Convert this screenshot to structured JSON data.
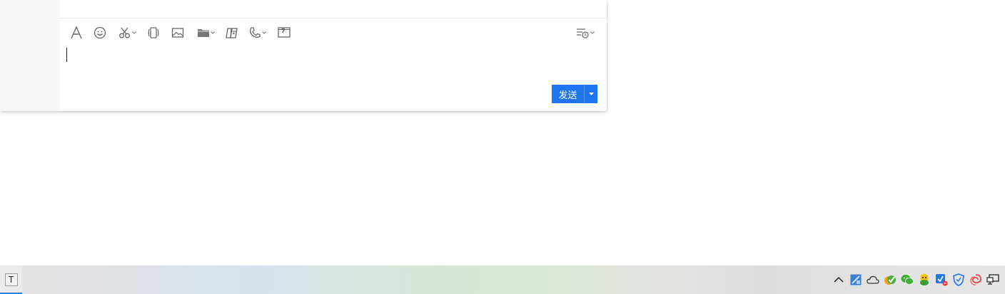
{
  "chat": {
    "toolbar": {
      "items": [
        {
          "name": "font-icon"
        },
        {
          "name": "emoji-icon"
        },
        {
          "name": "screenshot-scissors-icon",
          "dropdown": true
        },
        {
          "name": "shake-window-icon"
        },
        {
          "name": "image-icon"
        },
        {
          "name": "folder-icon",
          "dropdown": true
        },
        {
          "name": "red-packet-icon"
        },
        {
          "name": "phone-call-icon",
          "dropdown": true
        },
        {
          "name": "calendar-7-icon",
          "label": "7"
        }
      ],
      "history_icon": "message-history-icon"
    },
    "input": {
      "value": ""
    },
    "send": {
      "label": "发送",
      "more_icon": "caret-down-icon",
      "color": "#1f75f0"
    }
  },
  "taskbar": {
    "app": {
      "icon_letter": "T",
      "active_color": "#2f7fd6"
    },
    "tray": [
      "show-hidden-icons-chevron-icon",
      "network-drive-icon",
      "onedrive-cloud-icon",
      "green-check-app-icon",
      "wechat-icon",
      "qq-tray-icon",
      "shield-app-alert-icon",
      "security-shield-icon",
      "swirl-app-icon",
      "network-monitor-icon"
    ]
  }
}
